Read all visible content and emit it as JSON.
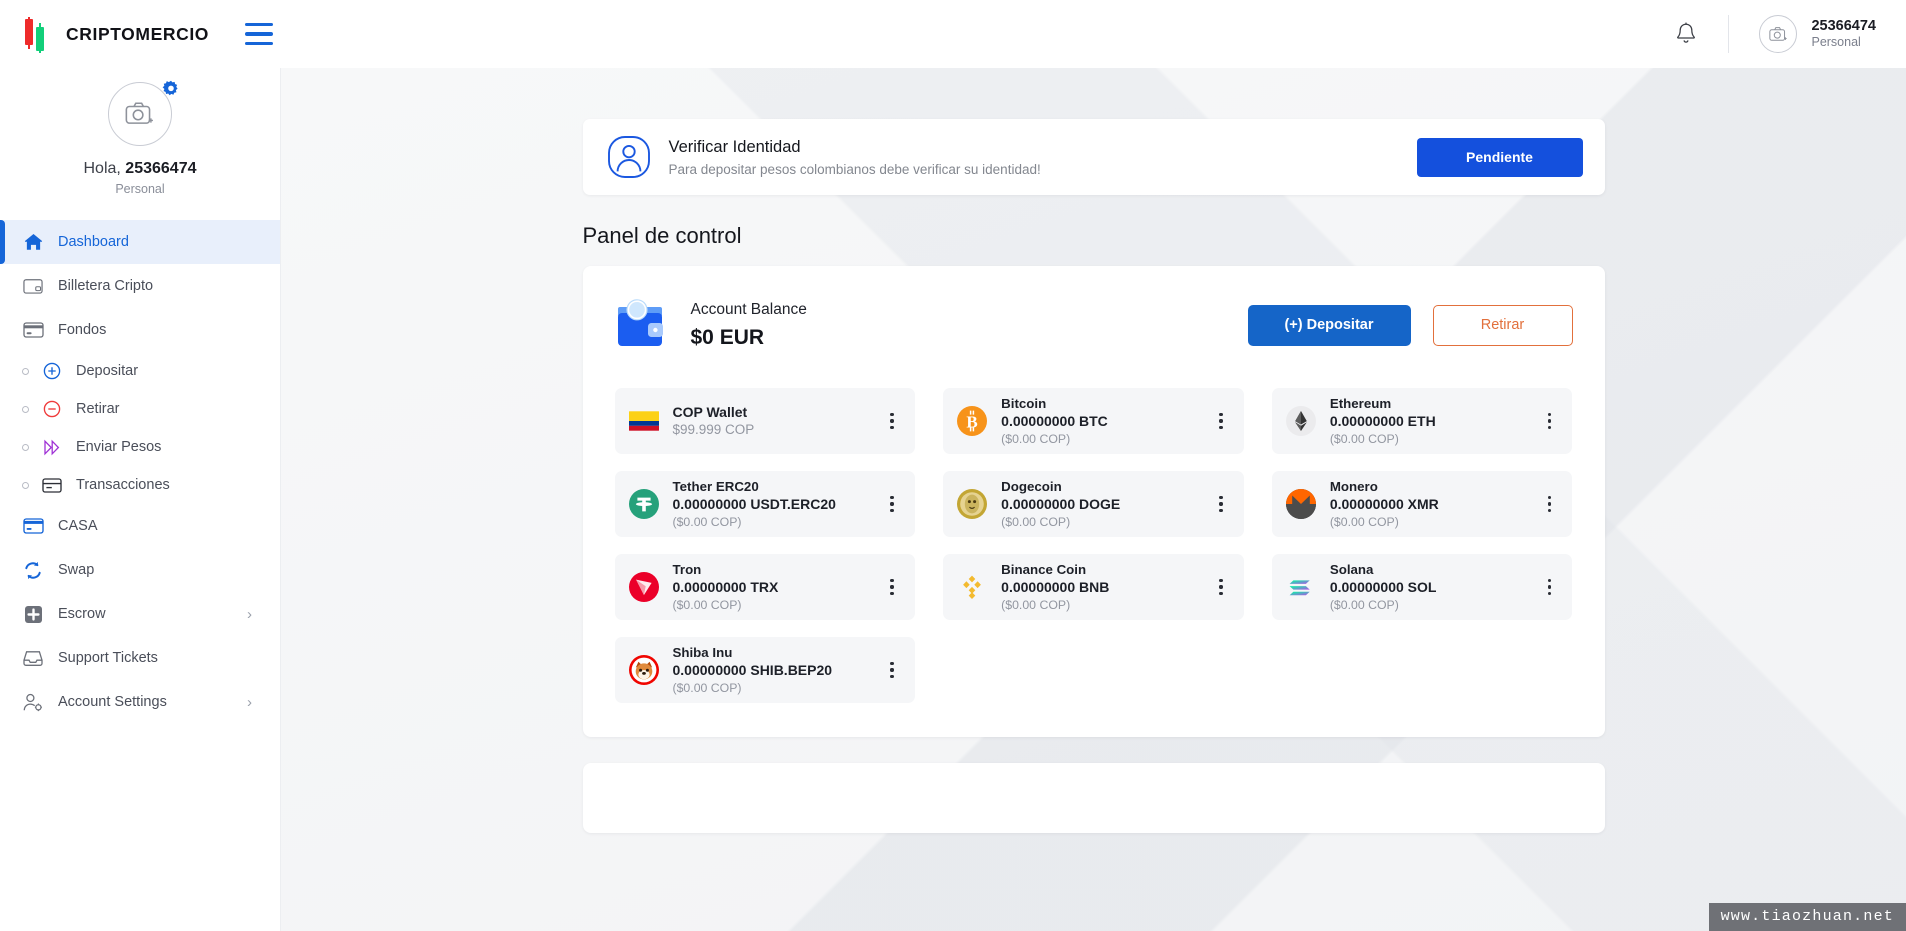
{
  "header": {
    "brand": "CRIPTOMERCIO",
    "logo_icon": "candlestick-logo",
    "menu_icon": "hamburger-menu-icon",
    "notification_icon": "bell-icon",
    "avatar_icon": "camera-avatar-icon",
    "user_name": "25366474",
    "user_role": "Personal"
  },
  "sidebar": {
    "avatar_icon": "camera-add-icon",
    "settings_badge_icon": "gear-icon",
    "greeting_prefix": "Hola, ",
    "user_name": "25366474",
    "role": "Personal",
    "items": [
      {
        "label": "Dashboard",
        "icon": "home-icon",
        "active": true
      },
      {
        "label": "Billetera Cripto",
        "icon": "wallet-card-icon",
        "active": false
      },
      {
        "label": "Fondos",
        "icon": "credit-card-icon",
        "active": false
      }
    ],
    "sub_items": [
      {
        "label": "Depositar",
        "icon": "plus-circle-icon"
      },
      {
        "label": "Retirar",
        "icon": "minus-circle-icon"
      },
      {
        "label": "Enviar Pesos",
        "icon": "send-forward-icon"
      },
      {
        "label": "Transacciones",
        "icon": "transaction-card-icon"
      }
    ],
    "items_lower": [
      {
        "label": "CASA",
        "icon": "casa-card-icon",
        "chevron": false
      },
      {
        "label": "Swap",
        "icon": "swap-refresh-icon",
        "chevron": false
      },
      {
        "label": "Escrow",
        "icon": "escrow-plus-icon",
        "chevron": true
      },
      {
        "label": "Support Tickets",
        "icon": "inbox-icon",
        "chevron": false
      },
      {
        "label": "Account Settings",
        "icon": "user-cog-icon",
        "chevron": true
      }
    ],
    "chevron_glyph": "›"
  },
  "verify_banner": {
    "icon": "user-identity-icon",
    "title": "Verificar Identidad",
    "subtitle": "Para depositar pesos colombianos debe verificar su identidad!",
    "button_label": "Pendiente",
    "button_color": "#1450dd"
  },
  "panel": {
    "title": "Panel de control"
  },
  "balance": {
    "icon": "wallet-icon",
    "label": "Account Balance",
    "amount": "$0 EUR",
    "deposit_label": "(+) Depositar",
    "withdraw_label": "Retirar",
    "deposit_color": "#1565c8",
    "withdraw_color": "#e2703c"
  },
  "wallets": [
    {
      "name": "COP Wallet",
      "amount": "$99.999 COP",
      "fiat": "",
      "icon": "colombia-flag-icon",
      "type": "fiat",
      "kebab_icon": "kebab-menu-icon"
    },
    {
      "name": "Bitcoin",
      "amount": "0.00000000 BTC",
      "fiat": "($0.00 COP)",
      "icon": "bitcoin-icon",
      "type": "crypto",
      "kebab_icon": "kebab-menu-icon"
    },
    {
      "name": "Ethereum",
      "amount": "0.00000000 ETH",
      "fiat": "($0.00 COP)",
      "icon": "ethereum-icon",
      "type": "crypto",
      "kebab_icon": "kebab-menu-icon"
    },
    {
      "name": "Tether ERC20",
      "amount": "0.00000000 USDT.ERC20",
      "fiat": "($0.00 COP)",
      "icon": "tether-icon",
      "type": "crypto",
      "kebab_icon": "kebab-menu-icon"
    },
    {
      "name": "Dogecoin",
      "amount": "0.00000000 DOGE",
      "fiat": "($0.00 COP)",
      "icon": "dogecoin-icon",
      "type": "crypto",
      "kebab_icon": "kebab-menu-icon"
    },
    {
      "name": "Monero",
      "amount": "0.00000000 XMR",
      "fiat": "($0.00 COP)",
      "icon": "monero-icon",
      "type": "crypto",
      "kebab_icon": "kebab-menu-icon"
    },
    {
      "name": "Tron",
      "amount": "0.00000000 TRX",
      "fiat": "($0.00 COP)",
      "icon": "tron-icon",
      "type": "crypto",
      "kebab_icon": "kebab-menu-icon"
    },
    {
      "name": "Binance Coin",
      "amount": "0.00000000 BNB",
      "fiat": "($0.00 COP)",
      "icon": "binance-icon",
      "type": "crypto",
      "kebab_icon": "kebab-menu-icon"
    },
    {
      "name": "Solana",
      "amount": "0.00000000 SOL",
      "fiat": "($0.00 COP)",
      "icon": "solana-icon",
      "type": "crypto",
      "kebab_icon": "kebab-menu-icon"
    },
    {
      "name": "Shiba Inu",
      "amount": "0.00000000 SHIB.BEP20",
      "fiat": "($0.00 COP)",
      "icon": "shiba-inu-icon",
      "type": "crypto",
      "kebab_icon": "kebab-menu-icon"
    }
  ],
  "watermark": "www.tiaozhuan.net"
}
